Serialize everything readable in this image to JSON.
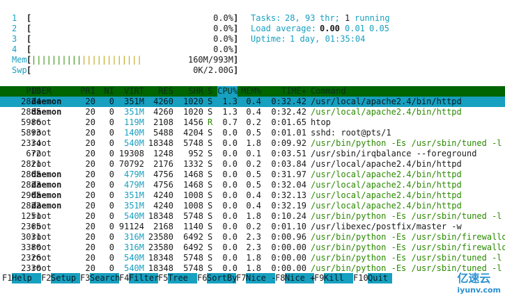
{
  "cpus": [
    {
      "id": "1",
      "bracket_open": "[",
      "value": "0.0%",
      "bracket_close": "]"
    },
    {
      "id": "2",
      "bracket_open": "[",
      "value": "0.0%",
      "bracket_close": "]"
    },
    {
      "id": "3",
      "bracket_open": "[",
      "value": "0.0%",
      "bracket_close": "]"
    },
    {
      "id": "4",
      "bracket_open": "[",
      "value": "0.0%",
      "bracket_close": "]"
    }
  ],
  "mem": {
    "label": "Mem",
    "bar_green": "||||||||||",
    "bar_yellow": "||||||||||||",
    "value": "160M/993M"
  },
  "swap": {
    "label": "Swp",
    "value": "0K/2.00G"
  },
  "summary": {
    "tasks_label": "Tasks:",
    "tasks": "28,",
    "threads": "93",
    "thr_label": "thr;",
    "running": "1",
    "running_label": "running",
    "load_label": "Load average:",
    "load1": "0.00",
    "load5": "0.01",
    "load15": "0.05",
    "uptime_label": "Uptime:",
    "uptime": "1 day, 01:35:04"
  },
  "columns": [
    "PID",
    "USER",
    "PRI",
    "NI",
    "VIRT",
    "RES",
    "SHR",
    "S",
    "CPU%",
    "MEM%",
    "TIME+",
    "Command"
  ],
  "processes": [
    {
      "pid": "2824",
      "user": "daemon",
      "pri": "20",
      "ni": "0",
      "virt": "351M",
      "res": "4260",
      "shr": "1020",
      "s": "S",
      "cpu": "1.3",
      "mem": "0.4",
      "time": "0:32.42",
      "cmd": "/usr/local/apache2.4/bin/httpd"
    },
    {
      "pid": "2885",
      "user": "daemon",
      "pri": "20",
      "ni": "0",
      "virt": "351M",
      "res": "4260",
      "shr": "1020",
      "s": "S",
      "cpu": "1.3",
      "mem": "0.4",
      "time": "0:32.42",
      "cmd": "/usr/local/apache2.4/bin/httpd"
    },
    {
      "pid": "5986",
      "user": "root",
      "pri": "20",
      "ni": "0",
      "virt": "119M",
      "res": "2108",
      "shr": "1456",
      "s": "R",
      "cpu": "0.7",
      "mem": "0.2",
      "time": "0:01.65",
      "cmd": "htop"
    },
    {
      "pid": "5893",
      "user": "root",
      "pri": "20",
      "ni": "0",
      "virt": "140M",
      "res": "5488",
      "shr": "4204",
      "s": "S",
      "cpu": "0.0",
      "mem": "0.5",
      "time": "0:01.01",
      "cmd": "sshd: root@pts/1"
    },
    {
      "pid": "2334",
      "user": "root",
      "pri": "20",
      "ni": "0",
      "virt": "540M",
      "res": "18348",
      "shr": "5748",
      "s": "S",
      "cpu": "0.0",
      "mem": "1.8",
      "time": "0:09.92",
      "cmd": "/usr/bin/python -Es /usr/sbin/tuned -l -"
    },
    {
      "pid": "672",
      "user": "root",
      "pri": "20",
      "ni": "0",
      "virt": "19308",
      "res": "1248",
      "shr": "952",
      "s": "S",
      "cpu": "0.0",
      "mem": "0.1",
      "time": "0:03.51",
      "cmd": "/usr/sbin/irqbalance --foreground"
    },
    {
      "pid": "2821",
      "user": "root",
      "pri": "20",
      "ni": "0",
      "virt": "70792",
      "res": "2176",
      "shr": "1332",
      "s": "S",
      "cpu": "0.0",
      "mem": "0.2",
      "time": "0:03.84",
      "cmd": "/usr/local/apache2.4/bin/httpd"
    },
    {
      "pid": "2865",
      "user": "daemon",
      "pri": "20",
      "ni": "0",
      "virt": "479M",
      "res": "4756",
      "shr": "1468",
      "s": "S",
      "cpu": "0.0",
      "mem": "0.5",
      "time": "0:31.97",
      "cmd": "/usr/local/apache2.4/bin/httpd"
    },
    {
      "pid": "2823",
      "user": "daemon",
      "pri": "20",
      "ni": "0",
      "virt": "479M",
      "res": "4756",
      "shr": "1468",
      "s": "S",
      "cpu": "0.0",
      "mem": "0.5",
      "time": "0:32.04",
      "cmd": "/usr/local/apache2.4/bin/httpd"
    },
    {
      "pid": "2905",
      "user": "daemon",
      "pri": "20",
      "ni": "0",
      "virt": "351M",
      "res": "4240",
      "shr": "1008",
      "s": "S",
      "cpu": "0.0",
      "mem": "0.4",
      "time": "0:32.13",
      "cmd": "/usr/local/apache2.4/bin/httpd"
    },
    {
      "pid": "2822",
      "user": "daemon",
      "pri": "20",
      "ni": "0",
      "virt": "351M",
      "res": "4240",
      "shr": "1008",
      "s": "S",
      "cpu": "0.0",
      "mem": "0.4",
      "time": "0:32.19",
      "cmd": "/usr/local/apache2.4/bin/httpd"
    },
    {
      "pid": "1251",
      "user": "root",
      "pri": "20",
      "ni": "0",
      "virt": "540M",
      "res": "18348",
      "shr": "5748",
      "s": "S",
      "cpu": "0.0",
      "mem": "1.8",
      "time": "0:10.24",
      "cmd": "/usr/bin/python -Es /usr/sbin/tuned -l -"
    },
    {
      "pid": "2365",
      "user": "root",
      "pri": "20",
      "ni": "0",
      "virt": "91124",
      "res": "2168",
      "shr": "1140",
      "s": "S",
      "cpu": "0.0",
      "mem": "0.2",
      "time": "0:01.10",
      "cmd": "/usr/libexec/postfix/master -w"
    },
    {
      "pid": "3031",
      "user": "root",
      "pri": "20",
      "ni": "0",
      "virt": "316M",
      "res": "23580",
      "shr": "6492",
      "s": "S",
      "cpu": "0.0",
      "mem": "2.3",
      "time": "0:00.96",
      "cmd": "/usr/bin/python -Es /usr/sbin/firewalld"
    },
    {
      "pid": "3380",
      "user": "root",
      "pri": "20",
      "ni": "0",
      "virt": "316M",
      "res": "23580",
      "shr": "6492",
      "s": "S",
      "cpu": "0.0",
      "mem": "2.3",
      "time": "0:00.00",
      "cmd": "/usr/bin/python -Es /usr/sbin/firewalld"
    },
    {
      "pid": "2326",
      "user": "root",
      "pri": "20",
      "ni": "0",
      "virt": "540M",
      "res": "18348",
      "shr": "5748",
      "s": "S",
      "cpu": "0.0",
      "mem": "1.8",
      "time": "0:00.00",
      "cmd": "/usr/bin/python -Es /usr/sbin/tuned -l -"
    },
    {
      "pid": "2330",
      "user": "root",
      "pri": "20",
      "ni": "0",
      "virt": "540M",
      "res": "18348",
      "shr": "5748",
      "s": "S",
      "cpu": "0.0",
      "mem": "1.8",
      "time": "0:00.00",
      "cmd": "/usr/bin/python -Es /usr/sbin/tuned -l -"
    }
  ],
  "fkeys": [
    {
      "key": "F1",
      "label": "Help  "
    },
    {
      "key": "F2",
      "label": "Setup "
    },
    {
      "key": "F3",
      "label": "Search"
    },
    {
      "key": "F4",
      "label": "Filter"
    },
    {
      "key": "F5",
      "label": "Tree  "
    },
    {
      "key": "F6",
      "label": "SortBy"
    },
    {
      "key": "F7",
      "label": "Nice -"
    },
    {
      "key": "F8",
      "label": "Nice +"
    },
    {
      "key": "F9",
      "label": "Kill  "
    },
    {
      "key": "F10",
      "label": "Quit "
    }
  ],
  "watermark": {
    "main": "亿速云",
    "sub": "iyunv.com"
  },
  "colors": {
    "cyan": "#17a0c0",
    "header_green": "#006400",
    "cmd_green": "#2a8a00",
    "bar_yellow": "#b8a000"
  }
}
